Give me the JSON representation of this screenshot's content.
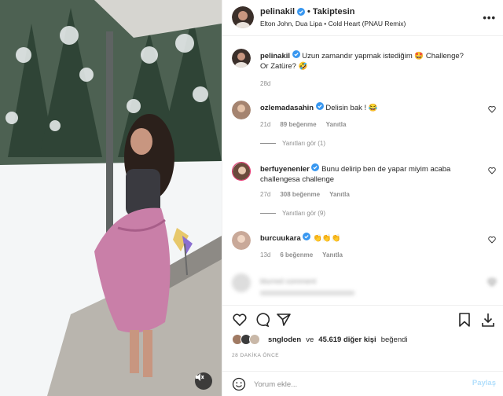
{
  "post": {
    "username": "pelinakil",
    "follow_label": "Takiptesin",
    "separator": "•",
    "song": "Elton John, Dua Lipa • Cold Heart (PNAU Remix)",
    "more_label": "•••",
    "icons": {
      "verified": "verified-badge-icon",
      "more": "more-options-icon",
      "mute": "sound-off-icon"
    }
  },
  "caption": {
    "username": "pelinakil",
    "text": "Uzun zamandır yapmak istediğim 🤩 Challenge? Or Zatüre? 🤣",
    "age": "28d"
  },
  "comments": [
    {
      "username": "ozlemadasahin",
      "text": "Delisin bak ! 😂",
      "age": "21d",
      "likes": "89 beğenme",
      "reply": "Yanıtla",
      "replies": "Yanıtları gör (1)"
    },
    {
      "username": "berfuyenenler",
      "text": "Bunu delirip ben de yapar miyim acaba challengesa challenge",
      "age": "27d",
      "likes": "308 beğenme",
      "reply": "Yanıtla",
      "replies": "Yanıtları gör (9)"
    },
    {
      "username": "burcuukara",
      "text": "👏👏👏",
      "age": "13d",
      "likes": "6 beğenme",
      "reply": "Yanıtla"
    },
    {
      "username": "blurred",
      "text": "blurred comment",
      "age": "",
      "likes": "",
      "reply": ""
    }
  ],
  "likes": {
    "first_user": "sngloden",
    "conjunction": "ve",
    "others": "45.619 diğer kişi",
    "suffix": "beğendi"
  },
  "time_ago": "28 DAKİKA ÖNCE",
  "add_comment": {
    "placeholder": "Yorum ekle...",
    "post_label": "Paylaş"
  },
  "colors": {
    "accent": "#0095f6",
    "post_disabled": "#b2dffc",
    "muted_text": "#8e8e8e",
    "verified": "#3897f0"
  }
}
